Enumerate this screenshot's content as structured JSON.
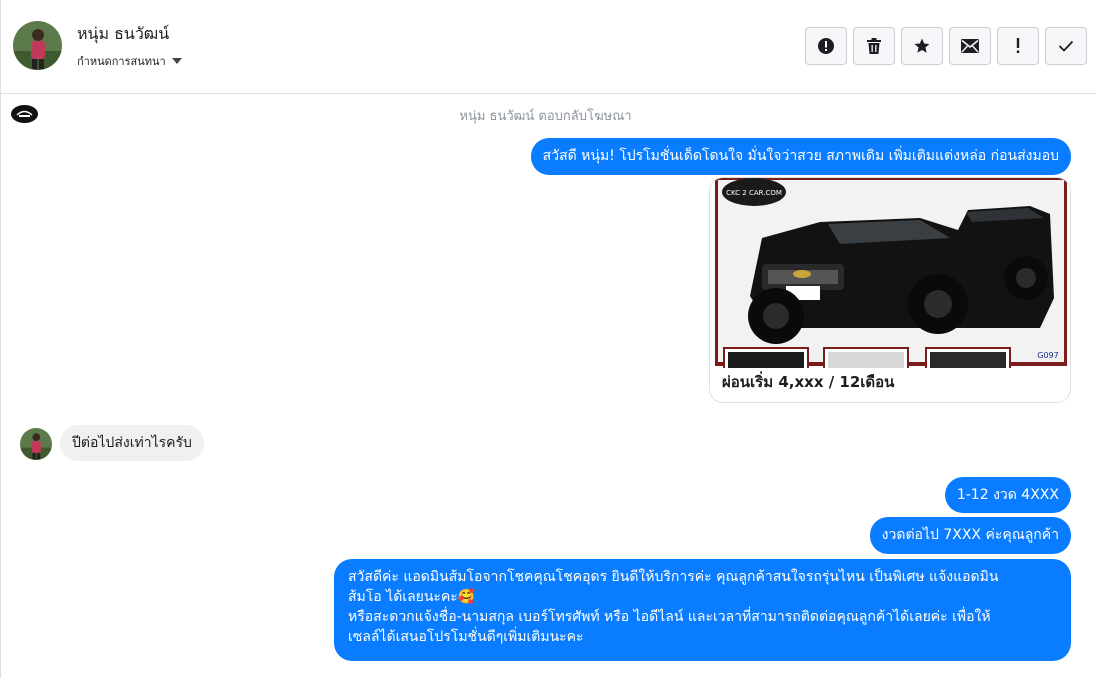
{
  "contact": {
    "name": "หนุ่ม ธนวัฒน์",
    "assign_label": "กำหนดการสนทนา"
  },
  "actions": [
    {
      "name": "alert-icon"
    },
    {
      "name": "trash-icon"
    },
    {
      "name": "star-icon"
    },
    {
      "name": "envelope-icon"
    },
    {
      "name": "exclamation-icon"
    },
    {
      "name": "check-icon"
    }
  ],
  "thread": {
    "reply_note": "หนุ่ม ธนวัฒน์ ตอบกลับโฆษณา",
    "messages": [
      {
        "direction": "out",
        "text": "สวัสดี หนุ่ม! โปรโมชั่นเด็ดโดนใจ มั่นใจว่าสวย สภาพเดิม เพิ่มเติมแต่งหล่อ ก่อนส่งมอบ"
      },
      {
        "direction": "out",
        "type": "ad-card",
        "logo_text": "CKC 2 CAR.COM",
        "code": "G097",
        "caption": "ผ่อนเริ่ม 4,xxx / 12เดือน"
      },
      {
        "direction": "in",
        "text": "ปีต่อไปส่งเท่าไรครับ"
      },
      {
        "direction": "out",
        "text": "1-12 งวด 4XXX"
      },
      {
        "direction": "out",
        "text": "งวดต่อไป 7XXX ค่ะคุณลูกค้า"
      },
      {
        "direction": "out",
        "lines": [
          "สวัสดีค่ะ แอดมินส้มโอจากโชคคุณโชคอุดร ยินดีให้บริการค่ะ   คุณลูกค้าสนใจรถรุ่นไหน เป็นพิเศษ แจ้งแอดมิน",
          "ส้มโอ ได้เลยนะคะ🥰",
          "หรือสะดวกแจ้งชื่อ-นามสกุล เบอร์โทรศัพท์ หรือ ไอดีไลน์ และเวลาที่สามารถติดต่อคุณลูกค้าได้เลยค่ะ เพื่อให้",
          "เซลล์ได้เสนอโปรโมชั่นดีๆเพิ่มเติมนะคะ"
        ]
      }
    ]
  },
  "colors": {
    "outgoing_bubble": "#0a7cff",
    "incoming_bubble": "#f1f0f0",
    "muted_text": "#8d949e"
  }
}
